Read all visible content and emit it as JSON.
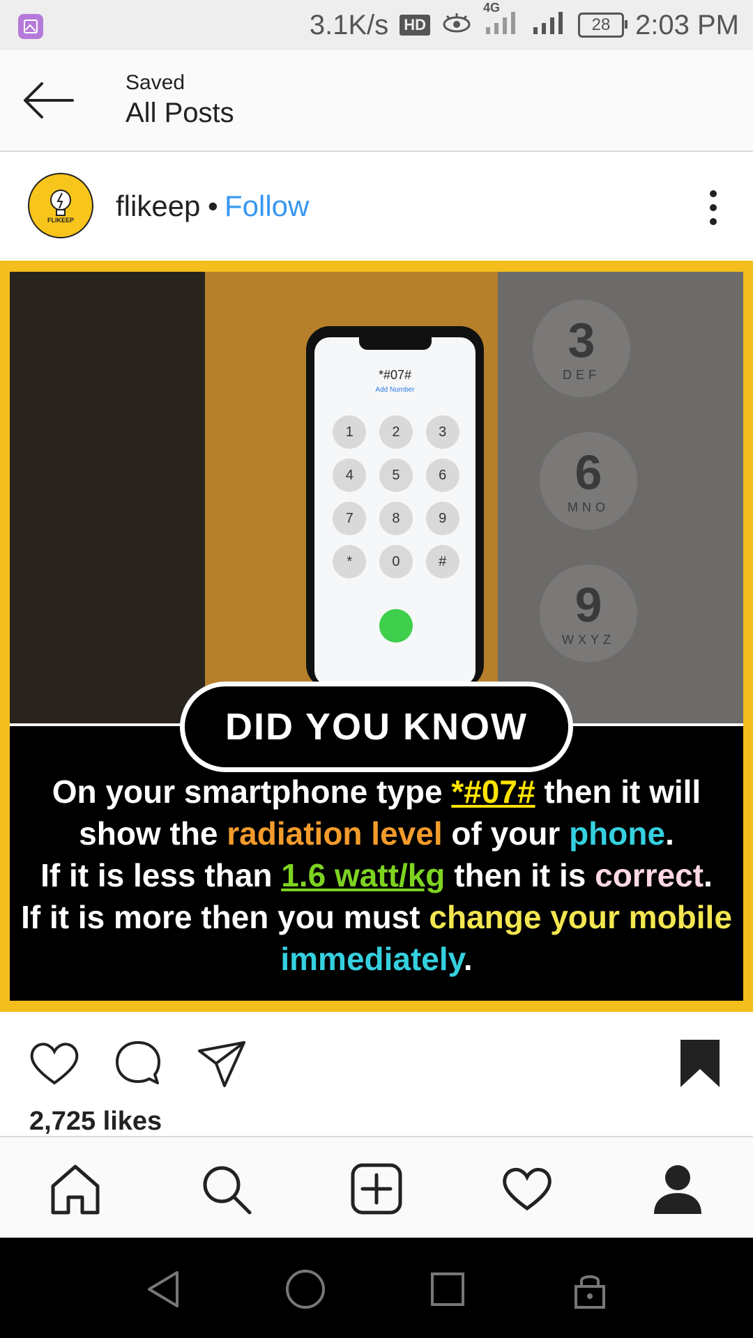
{
  "status_bar": {
    "speed": "3.1K/s",
    "hd_label": "HD",
    "network": "4G",
    "battery": "28",
    "time": "2:03 PM"
  },
  "header": {
    "subtitle": "Saved",
    "title": "All Posts"
  },
  "post": {
    "username": "flikeep",
    "separator": "•",
    "follow_label": "Follow",
    "avatar_label": "FLIKEEP",
    "likes": "2,725 likes"
  },
  "image": {
    "dialer_code": "*#07#",
    "add_number": "Add Number",
    "keys": [
      "1",
      "2",
      "3",
      "4",
      "5",
      "6",
      "7",
      "8",
      "9",
      "*",
      "0",
      "#"
    ],
    "big_keys": [
      {
        "digit": "3",
        "letters": "DEF"
      },
      {
        "digit": "6",
        "letters": "MNO"
      },
      {
        "digit": "9",
        "letters": "WXYZ"
      }
    ],
    "banner": "DID YOU KNOW",
    "line1_a": "On your smartphone type ",
    "line1_b": "*#07#",
    "line1_c": " then it will",
    "line2_a": "show the ",
    "line2_b": "radiation level",
    "line2_c": " of your ",
    "line2_d": "phone",
    "line2_e": ".",
    "line3_a": "If it is less than ",
    "line3_b": "1.6 watt/kg",
    "line3_c": " then it is ",
    "line3_d": "correct",
    "line3_e": ".",
    "line4_a": "If it is more then you must ",
    "line4_b": "change your mobile",
    "line5_a": "immediately",
    "line5_b": "."
  },
  "colors": {
    "follow": "#3897f0",
    "frame": "#f4bf1c"
  }
}
